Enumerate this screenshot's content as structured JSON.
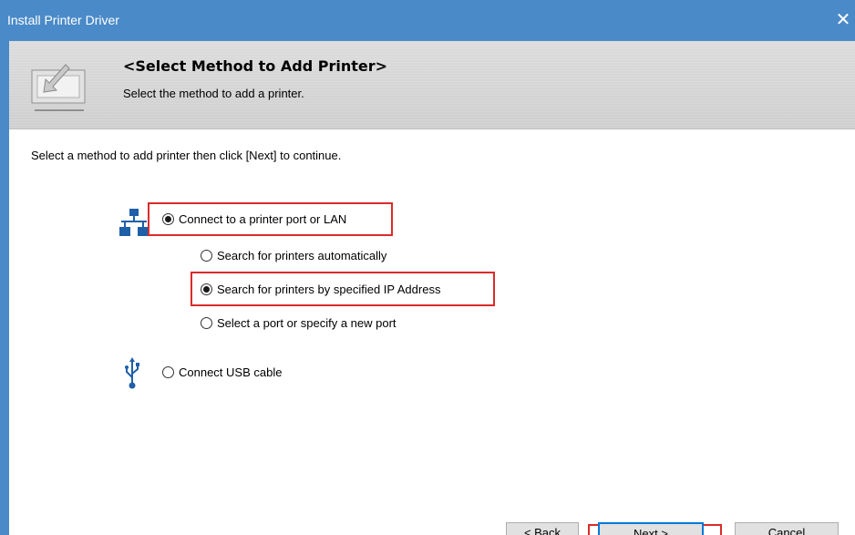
{
  "window": {
    "title": "Install Printer Driver",
    "close_glyph": "✕"
  },
  "header": {
    "title": "<Select Method to Add Printer>",
    "subtitle": "Select the method to add a printer.",
    "icon": "printer-install-icon"
  },
  "instruction": "Select a method to add printer then click [Next] to continue.",
  "options": {
    "lan": {
      "label": "Connect to a printer port or LAN",
      "selected": true,
      "icon": "network-icon"
    },
    "auto": {
      "label": "Search for printers automatically",
      "selected": false
    },
    "ip": {
      "label": "Search for printers by specified IP Address",
      "selected": true
    },
    "port": {
      "label": "Select a port or specify a new port",
      "selected": false
    },
    "usb": {
      "label": "Connect USB cable",
      "selected": false,
      "icon": "usb-icon"
    }
  },
  "buttons": {
    "back": "< Back",
    "next": "Next >",
    "cancel": "Cancel"
  },
  "colors": {
    "titlebar": "#4a8ac8",
    "highlight": "#d92b2b",
    "icon_blue": "#1f5fa8",
    "default_button_border": "#0078d7"
  }
}
